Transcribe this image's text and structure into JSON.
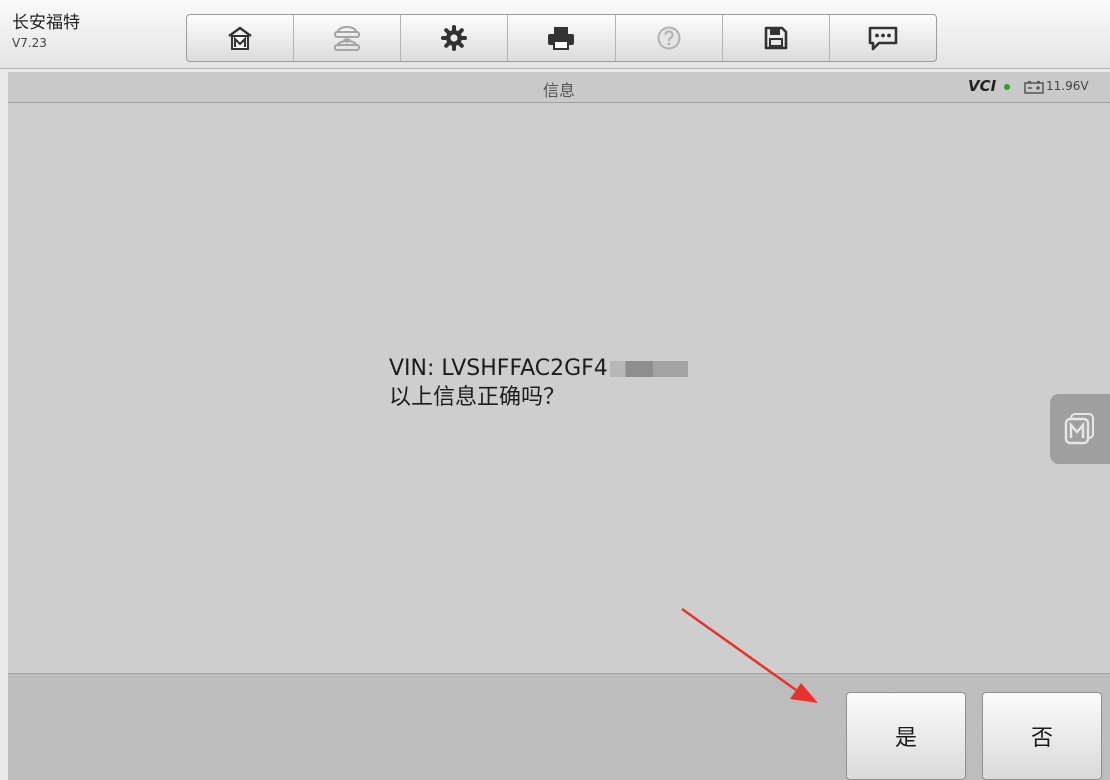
{
  "app": {
    "name": "长安福特",
    "version": "V7.23"
  },
  "toolbar": [
    {
      "icon": "home-m-icon"
    },
    {
      "icon": "vehicle-swap-icon"
    },
    {
      "icon": "gear-icon"
    },
    {
      "icon": "printer-icon"
    },
    {
      "icon": "help-icon"
    },
    {
      "icon": "save-icon"
    },
    {
      "icon": "chat-icon"
    }
  ],
  "titlebar": {
    "title": "信息",
    "vci": "VCI",
    "battery": "11.96V"
  },
  "message": {
    "vin_line": "VIN: LVSHFFAC2GF4",
    "question": "以上信息正确吗？"
  },
  "buttons": {
    "yes": "是",
    "no": "否"
  },
  "colors": {
    "accent_arrow": "#e8322b",
    "vci_status": "#26a326"
  }
}
